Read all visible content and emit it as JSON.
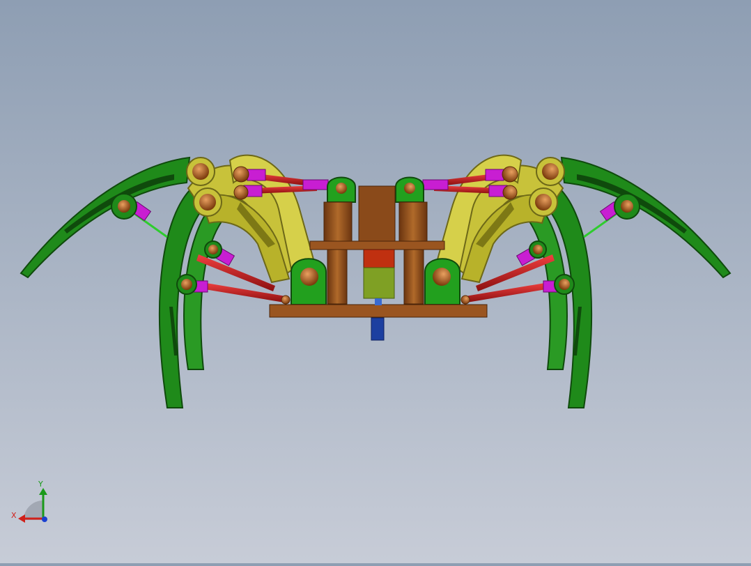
{
  "viewport": {
    "background_top": "#8e9eb3",
    "background_bottom": "#c7ccd7"
  },
  "model": {
    "colors": {
      "leg_green": "#1f8a1a",
      "leg_green_dark": "#0f5a0c",
      "link_yellow": "#c8c23a",
      "link_yellow_dark": "#8d8520",
      "actuator_red": "#d21e1e",
      "actuator_red_dark": "#8a0f0f",
      "clevis_magenta": "#c81ed2",
      "pin_bronze": "#b8641e",
      "body_brown": "#8a4a1a",
      "body_brown_dark": "#5a2e0e",
      "battery_olive": "#7fa024",
      "motor_red": "#c03010",
      "shaft_blue": "#1c3fa0",
      "rod_green": "#2ecc2e"
    }
  },
  "triad": {
    "x_label": "X",
    "y_label": "Y",
    "x_color": "#d0201a",
    "y_color": "#1a9a1a",
    "z_color": "#1a40d0"
  }
}
